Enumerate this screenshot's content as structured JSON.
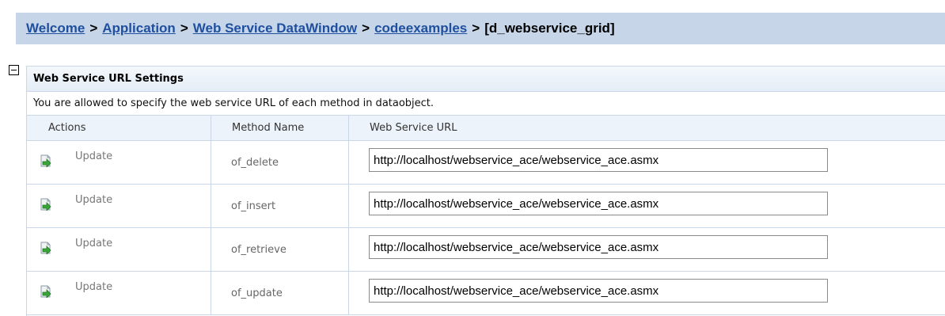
{
  "breadcrumb": {
    "items": [
      {
        "label": "Welcome"
      },
      {
        "label": "Application"
      },
      {
        "label": "Web Service DataWindow"
      },
      {
        "label": "codeexamples"
      }
    ],
    "separator": ">",
    "current": "[d_webservice_grid]"
  },
  "panel": {
    "title": "Web Service URL Settings",
    "description": "You are allowed to specify the web service URL of each method in dataobject.",
    "columns": {
      "actions": "Actions",
      "method": "Method Name",
      "url": "Web Service URL"
    },
    "rows": [
      {
        "action": "Update",
        "method": "of_delete",
        "url": "http://localhost/webservice_ace/webservice_ace.asmx"
      },
      {
        "action": "Update",
        "method": "of_insert",
        "url": "http://localhost/webservice_ace/webservice_ace.asmx"
      },
      {
        "action": "Update",
        "method": "of_retrieve",
        "url": "http://localhost/webservice_ace/webservice_ace.asmx"
      },
      {
        "action": "Update",
        "method": "of_update",
        "url": "http://localhost/webservice_ace/webservice_ace.asmx"
      }
    ]
  },
  "colors": {
    "breadcrumb_bg": "#c6d6e8",
    "link": "#1f4f9f",
    "border": "#c9d7e8",
    "icon_green": "#3aa53a"
  }
}
